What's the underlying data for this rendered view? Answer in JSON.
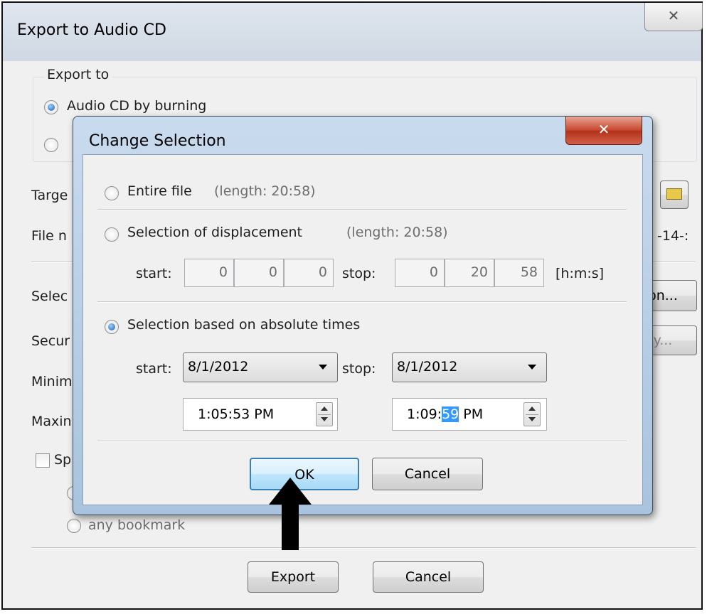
{
  "outer": {
    "title": "Export to Audio CD",
    "close_glyph": "✕",
    "export_group_label": "Export to",
    "radio_burn_label": "Audio CD by burning",
    "target_label": "Targe",
    "filename_label": "File n",
    "filename_right": "-14-:",
    "selection_label": "Selec",
    "selection_button": "on...",
    "security_label": "Secur",
    "security_button": "y...",
    "minimum_label": "Minim",
    "maximum_label": "Maxin",
    "split_label": "Sp",
    "bookmark_label": "any bookmark",
    "export_button": "Export",
    "cancel_button": "Cancel"
  },
  "dialog": {
    "title": "Change Selection",
    "close_glyph": "✕",
    "entire_file_label": "Entire file",
    "entire_file_length": "(length: 20:58)",
    "displacement_label": "Selection of displacement",
    "displacement_length": "(length: 20:58)",
    "start_label": "start:",
    "stop_label": "stop:",
    "disp_start": [
      "0",
      "0",
      "0"
    ],
    "disp_stop": [
      "0",
      "20",
      "58"
    ],
    "hms_label": "[h:m:s]",
    "absolute_label": "Selection based on absolute times",
    "abs_start_label": "start:",
    "abs_stop_label": "stop:",
    "start_date": "8/1/2012",
    "stop_date": "8/1/2012",
    "start_time": "1:05:53 PM",
    "stop_time_prefix": "1:09:",
    "stop_time_selected": "59",
    "stop_time_suffix": " PM",
    "ok_button": "OK",
    "cancel_button": "Cancel",
    "selected_option": "absolute"
  },
  "colors": {
    "accent": "#3399ff",
    "close_red": "#c7472f",
    "dialog_frame": "#b9cfe6"
  }
}
